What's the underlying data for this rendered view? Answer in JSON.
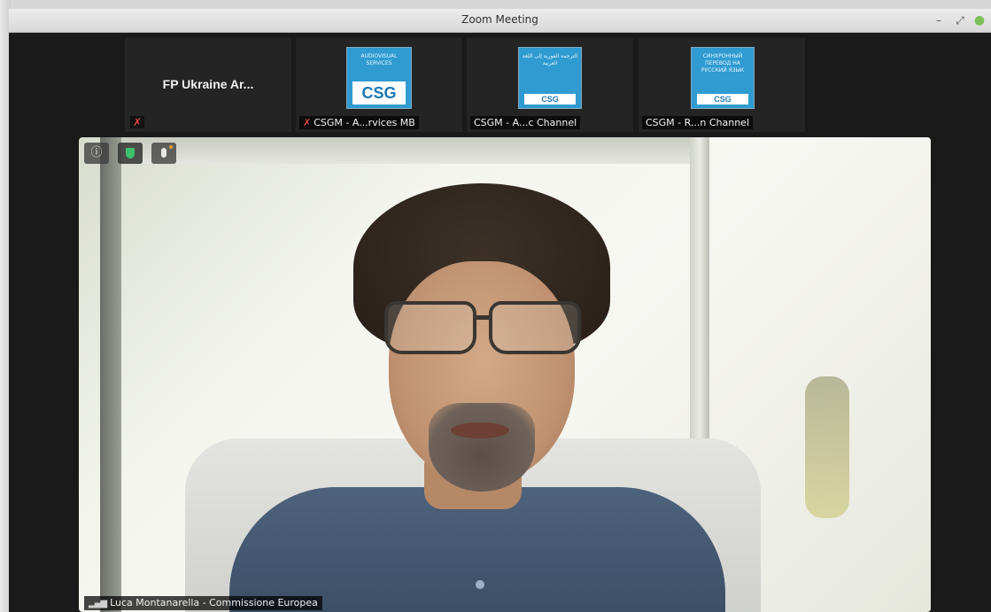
{
  "window": {
    "title": "Zoom Meeting",
    "controls": {
      "minimize": "–",
      "maximize": "⤢",
      "close": "●"
    }
  },
  "thumbnails": [
    {
      "name_big": "FP Ukraine Ar...",
      "muted": true,
      "mute_glyph": "✗"
    },
    {
      "label": "CSGM - A...rvices MB",
      "muted": true,
      "mute_glyph": "✗",
      "logo_text": "AUDIOVISUAL SERVICES",
      "logo_brand": "CSG"
    },
    {
      "label": "CSGM - A...c Channel",
      "muted": false,
      "logo_text": "الترجمة الفورية إلى اللغة العربية",
      "logo_brand": "CSG"
    },
    {
      "label": "CSGM - R...n Channel",
      "muted": false,
      "logo_text": "СИНХРОННЫЙ ПЕРЕВОД НА РУССКИЙ ЯЗЫК",
      "logo_brand": "CSG"
    }
  ],
  "main_video": {
    "controls": {
      "info_glyph": "ⓘ"
    },
    "speaker": {
      "signal_glyph": "▂▄▆",
      "name": "Luca Montanarella - Commissione Europea"
    }
  },
  "icons": {
    "info": "info-icon",
    "shield": "shield-icon",
    "mic": "microphone-icon",
    "signal": "signal-icon",
    "muted": "muted-microphone-icon"
  },
  "colors": {
    "window_bg": "#1a1a1a",
    "logo_blue": "#2f9bd1",
    "mute_red": "#e04646",
    "shield_green": "#3cc06b",
    "close_green": "#7cbf5a"
  }
}
